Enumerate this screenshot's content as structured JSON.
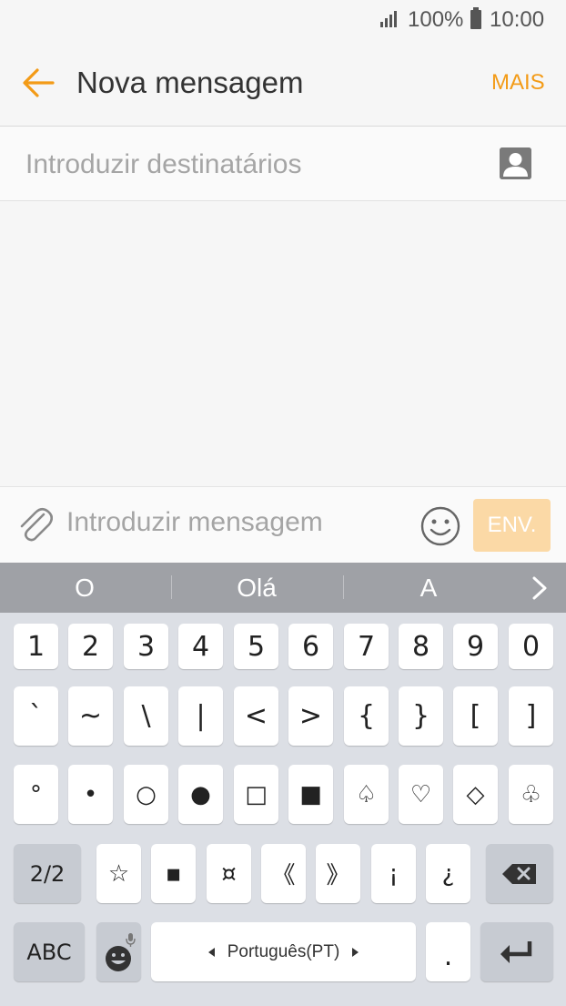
{
  "status": {
    "battery": "100%",
    "time": "10:00"
  },
  "header": {
    "title": "Nova mensagem",
    "more": "MAIS"
  },
  "recipients": {
    "placeholder": "Introduzir destinatários"
  },
  "compose": {
    "placeholder": "Introduzir mensagem",
    "send": "ENV."
  },
  "suggestions": [
    "O",
    "Olá",
    "A"
  ],
  "keyboard": {
    "row1": [
      "1",
      "2",
      "3",
      "4",
      "5",
      "6",
      "7",
      "8",
      "9",
      "0"
    ],
    "row2": [
      "`",
      "~",
      "\\",
      "|",
      "<",
      ">",
      "{",
      "}",
      "[",
      "]"
    ],
    "row3": [
      "°",
      "•",
      "○",
      "●",
      "□",
      "■",
      "♤",
      "♡",
      "◇",
      "♧"
    ],
    "row4": [
      "☆",
      "▪",
      "¤",
      "《",
      "》",
      "¡",
      "¿"
    ],
    "page": "2/2",
    "abc": "ABC",
    "language": "Português(PT)",
    "period": "."
  },
  "colors": {
    "accent": "#f39b17",
    "send_bg": "#fbd9a6",
    "suggestion_bar": "#9fa1a6",
    "keyboard_bg": "#dcdfe5"
  }
}
